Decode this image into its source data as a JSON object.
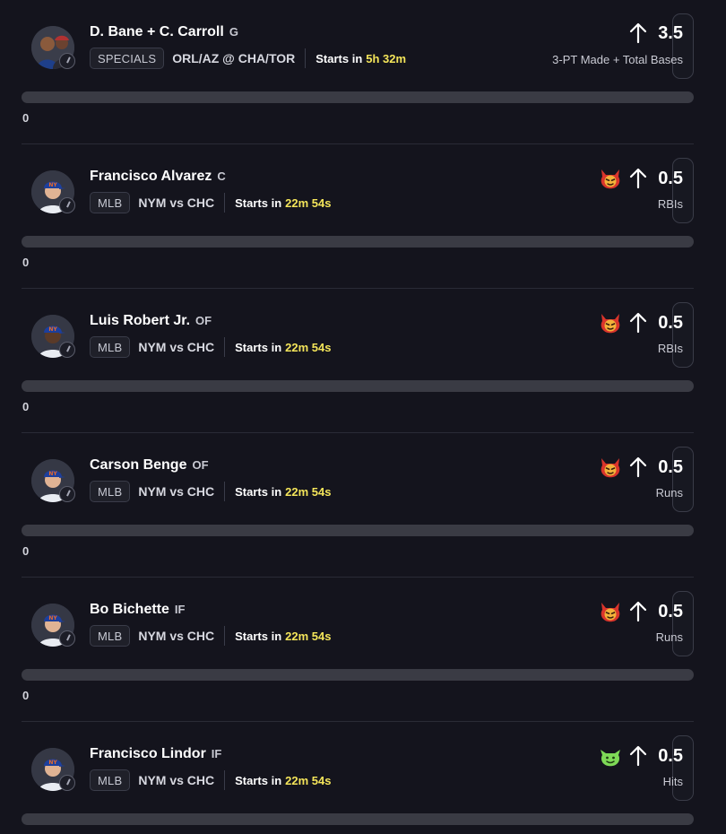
{
  "picks": [
    {
      "player_name": "D. Bane + C. Carroll",
      "position": "G",
      "league": "SPECIALS",
      "matchup": "ORL/AZ @ CHA/TOR",
      "starts_label": "Starts in",
      "starts_time": "5h 32m",
      "direction_icon": "arrow-up-icon",
      "line": "3.5",
      "stat": "3-PT Made + Total Bases",
      "badge": null,
      "progress_value": "0",
      "progress_fraction": 0,
      "avatar": "combo"
    },
    {
      "player_name": "Francisco Alvarez",
      "position": "C",
      "league": "MLB",
      "matchup": "NYM vs CHC",
      "starts_label": "Starts in",
      "starts_time": "22m 54s",
      "direction_icon": "arrow-up-icon",
      "line": "0.5",
      "stat": "RBIs",
      "badge": "red-demon-icon",
      "progress_value": "0",
      "progress_fraction": 0,
      "avatar": "mets-light"
    },
    {
      "player_name": "Luis Robert Jr.",
      "position": "OF",
      "league": "MLB",
      "matchup": "NYM vs CHC",
      "starts_label": "Starts in",
      "starts_time": "22m 54s",
      "direction_icon": "arrow-up-icon",
      "line": "0.5",
      "stat": "RBIs",
      "badge": "red-demon-icon",
      "progress_value": "0",
      "progress_fraction": 0,
      "avatar": "mets-dark"
    },
    {
      "player_name": "Carson Benge",
      "position": "OF",
      "league": "MLB",
      "matchup": "NYM vs CHC",
      "starts_label": "Starts in",
      "starts_time": "22m 54s",
      "direction_icon": "arrow-up-icon",
      "line": "0.5",
      "stat": "Runs",
      "badge": "red-demon-icon",
      "progress_value": "0",
      "progress_fraction": 0,
      "avatar": "mets-light"
    },
    {
      "player_name": "Bo Bichette",
      "position": "IF",
      "league": "MLB",
      "matchup": "NYM vs CHC",
      "starts_label": "Starts in",
      "starts_time": "22m 54s",
      "direction_icon": "arrow-up-icon",
      "line": "0.5",
      "stat": "Runs",
      "badge": "red-demon-icon",
      "progress_value": "0",
      "progress_fraction": 0,
      "avatar": "mets-light"
    },
    {
      "player_name": "Francisco Lindor",
      "position": "IF",
      "league": "MLB",
      "matchup": "NYM vs CHC",
      "starts_label": "Starts in",
      "starts_time": "22m 54s",
      "direction_icon": "arrow-up-icon",
      "line": "0.5",
      "stat": "Hits",
      "badge": "green-goblin-icon",
      "progress_value": "0",
      "progress_fraction": 0,
      "avatar": "mets-light"
    }
  ],
  "colors": {
    "background": "#14141d",
    "starts_time": "#f4e55a",
    "demon_red": "#d9342b",
    "goblin_green": "#7ed957",
    "progress_track": "#3a3b44"
  }
}
